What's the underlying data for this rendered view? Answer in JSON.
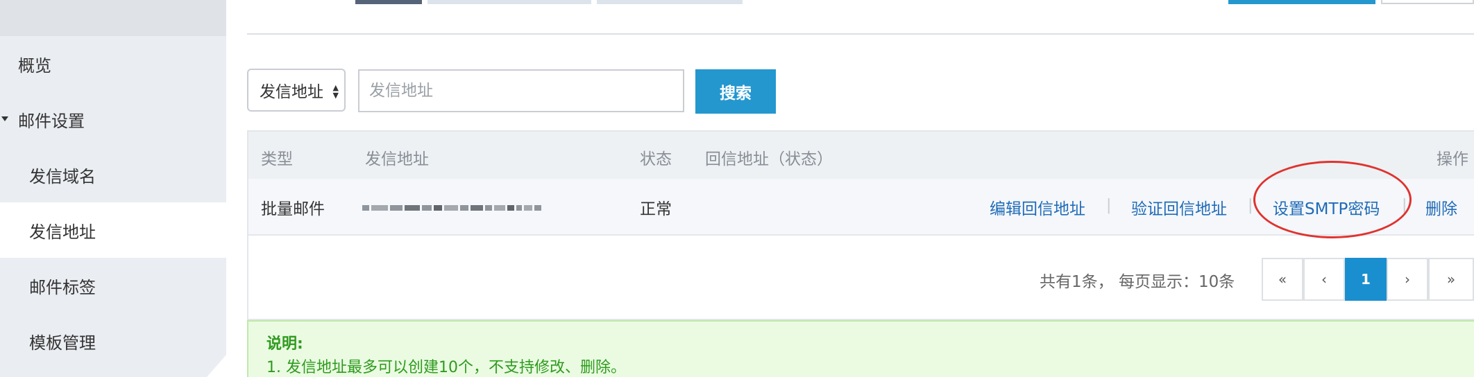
{
  "sidebar": {
    "items": [
      {
        "label": "概览",
        "level": "top"
      },
      {
        "label": "邮件设置",
        "level": "top",
        "expanded": true
      },
      {
        "label": "发信域名",
        "level": "sub"
      },
      {
        "label": "发信地址",
        "level": "sub",
        "active": true
      },
      {
        "label": "邮件标签",
        "level": "sub"
      },
      {
        "label": "模板管理",
        "level": "sub"
      }
    ]
  },
  "search": {
    "field_select": "发信地址",
    "placeholder": "发信地址",
    "button_label": "搜索"
  },
  "table": {
    "columns": [
      "类型",
      "发信地址",
      "状态",
      "回信地址（状态）",
      "操作"
    ],
    "rows": [
      {
        "type": "批量邮件",
        "sender_address": "",
        "status": "正常",
        "reply_address": "",
        "actions": [
          "编辑回信地址",
          "验证回信地址",
          "设置SMTP密码",
          "删除"
        ]
      }
    ]
  },
  "pagination": {
    "summary": "共有1条， 每页显示：10条",
    "first": "«",
    "prev": "‹",
    "current": "1",
    "next": "›",
    "last": "»"
  },
  "note": {
    "title": "说明:",
    "lines": [
      "1. 发信地址最多可以创建10个，不支持修改、删除。"
    ]
  },
  "colors": {
    "primary": "#2497cf",
    "link": "#1f6bb8",
    "highlight_circle": "#e0322e",
    "note_text": "#2f9a1e"
  }
}
